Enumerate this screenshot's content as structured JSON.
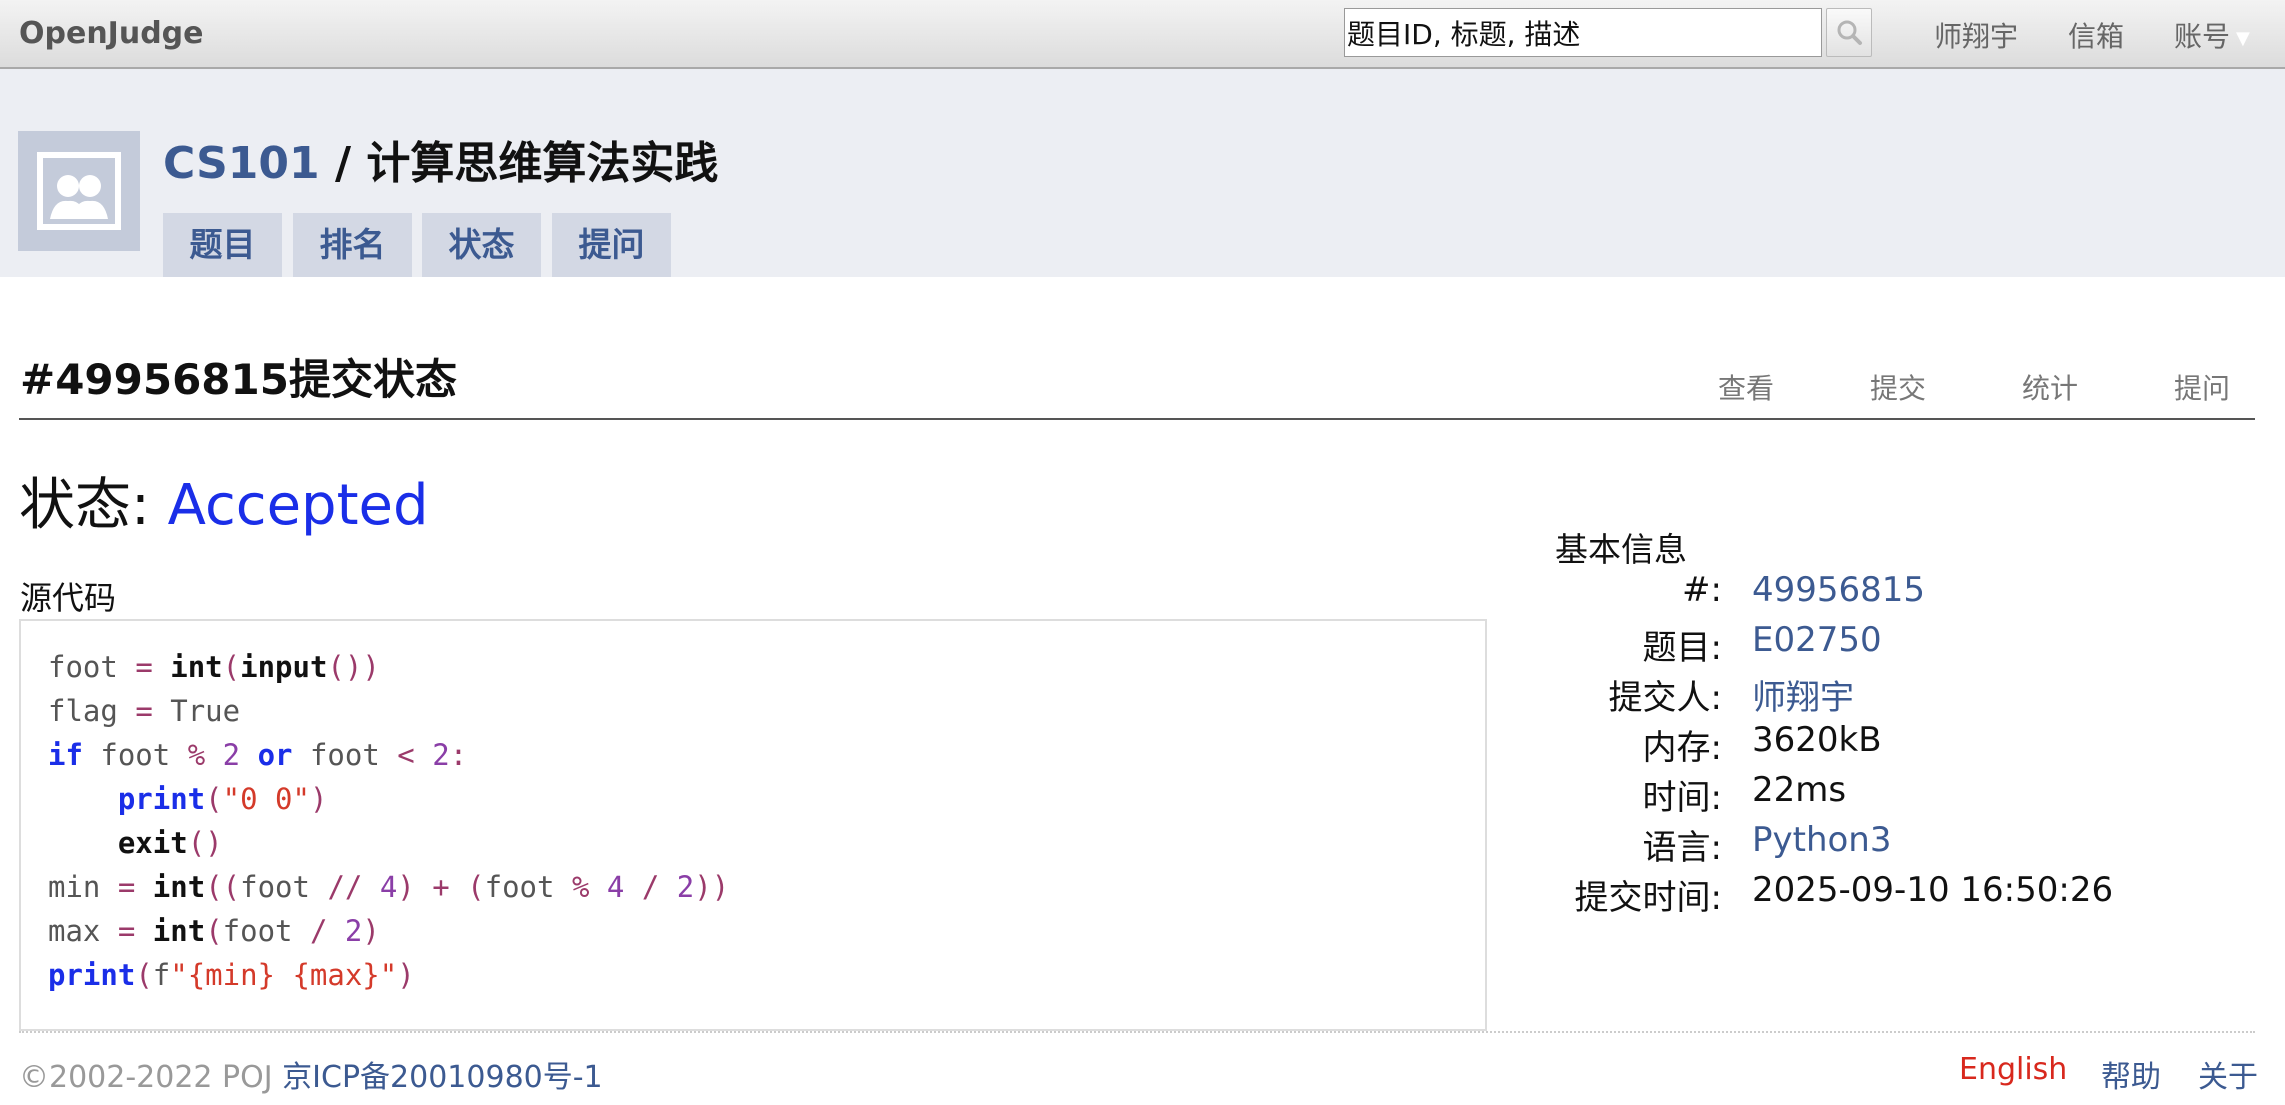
{
  "topbar": {
    "logo": "OpenJudge",
    "search": {
      "value": "题目ID, 标题, 描述"
    },
    "user": "师翔宇",
    "mailbox": "信箱",
    "account": "账号"
  },
  "course": {
    "code": "CS101",
    "separator": " / ",
    "name": "计算思维算法实践",
    "tabs": [
      "题目",
      "排名",
      "状态",
      "提问"
    ]
  },
  "page": {
    "title": "#49956815提交状态",
    "sublinks": [
      "查看",
      "提交",
      "统计",
      "提问"
    ]
  },
  "status": {
    "label": "状态: ",
    "value": "Accepted",
    "color": "#1a2ee8"
  },
  "source": {
    "label": "源代码",
    "lines": [
      "foot = int(input())",
      "flag = True",
      "if foot % 2 or foot < 2:",
      "    print(\"0 0\")",
      "    exit()",
      "min = int((foot // 4) + (foot % 4 / 2))",
      "max = int(foot / 2)",
      "print(f\"{min} {max}\")"
    ]
  },
  "info": {
    "title": "基本信息",
    "rows": [
      {
        "label": "#:",
        "value": "49956815"
      },
      {
        "label": "题目:",
        "value": "E02750"
      },
      {
        "label": "提交人:",
        "value": "师翔宇"
      },
      {
        "label": "内存:",
        "value": "3620kB"
      },
      {
        "label": "时间:",
        "value": "22ms"
      },
      {
        "label": "语言:",
        "value": "Python3"
      },
      {
        "label": "提交时间:",
        "value": "2025-09-10 16:50:26"
      }
    ]
  },
  "footer": {
    "copyright": "©2002-2022 POJ ",
    "icp": "京ICP备20010980号-1",
    "links": [
      "English",
      "帮助",
      "关于"
    ]
  }
}
